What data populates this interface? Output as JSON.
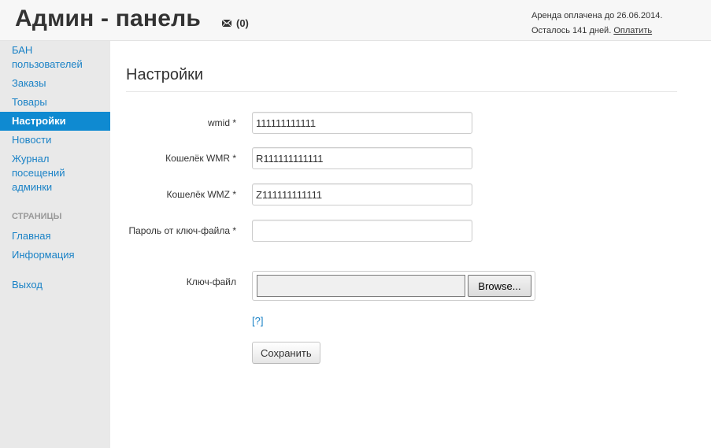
{
  "header": {
    "title": "Админ - панель",
    "messages_count": "(0)",
    "rent_paid_text": "Аренда оплачена до 26.06.2014.",
    "days_left_text": "Осталось 141 дней.",
    "pay_link": "Оплатить"
  },
  "sidebar": {
    "items": [
      {
        "label": "БАН пользователей"
      },
      {
        "label": "Заказы"
      },
      {
        "label": "Товары"
      },
      {
        "label": "Настройки"
      },
      {
        "label": "Новости"
      },
      {
        "label": "Журнал посещений админки"
      }
    ],
    "section_header": "СТРАНИЦЫ",
    "pages": [
      {
        "label": "Главная"
      },
      {
        "label": "Информация"
      }
    ],
    "logout": "Выход"
  },
  "main": {
    "page_title": "Настройки",
    "form": {
      "wmid_label": "wmid *",
      "wmid_value": "111111111111",
      "wmr_label": "Кошелёк WMR *",
      "wmr_value": "R111111111111",
      "wmz_label": "Кошелёк WMZ *",
      "wmz_value": "Z111111111111",
      "password_label": "Пароль от ключ-файла *",
      "password_value": "",
      "keyfile_label": "Ключ-файл",
      "browse_label": "Browse...",
      "help_link": "[?]",
      "save_label": "Сохранить"
    }
  },
  "colors": {
    "accent": "#0f8ad1",
    "link": "#1a82c6",
    "sidebar_bg": "#e9e9e9",
    "header_bg": "#f7f7f7"
  }
}
